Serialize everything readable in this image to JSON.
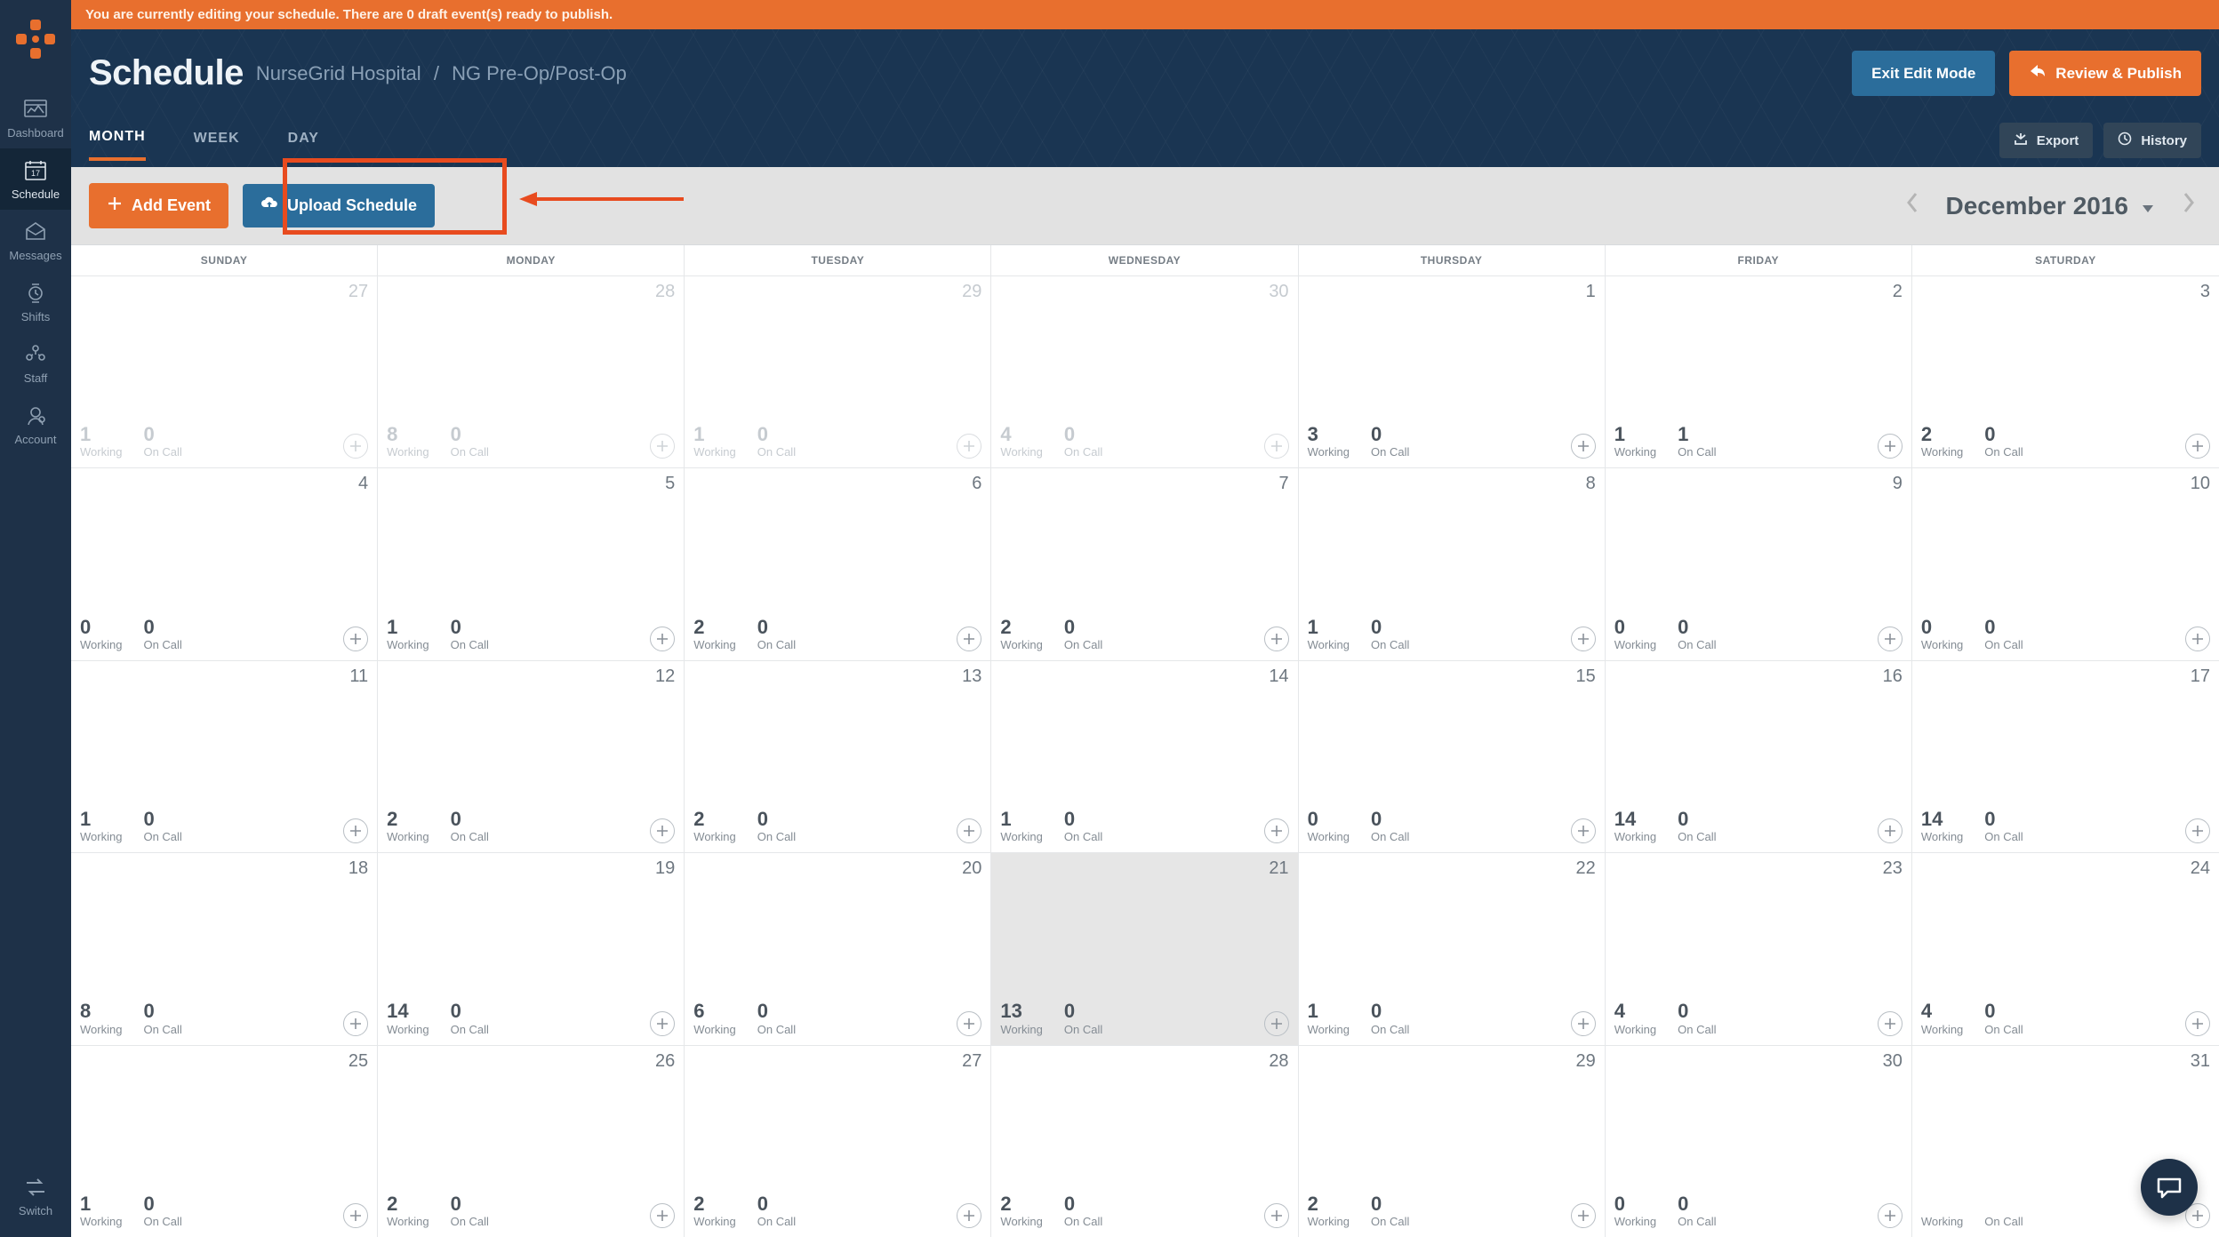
{
  "banner": "You are currently editing your schedule. There are 0 draft event(s) ready to publish.",
  "sidebar": {
    "items": [
      {
        "label": "Dashboard"
      },
      {
        "label": "Schedule"
      },
      {
        "label": "Messages"
      },
      {
        "label": "Shifts"
      },
      {
        "label": "Staff"
      },
      {
        "label": "Account"
      }
    ],
    "switch_label": "Switch"
  },
  "header": {
    "title": "Schedule",
    "crumb1": "NurseGrid Hospital",
    "crumb2": "NG Pre-Op/Post-Op",
    "exit_label": "Exit Edit Mode",
    "publish_label": "Review & Publish"
  },
  "tabs": {
    "month": "MONTH",
    "week": "WEEK",
    "day": "DAY",
    "export": "Export",
    "history": "History"
  },
  "toolbar": {
    "add_event": "Add Event",
    "upload": "Upload Schedule"
  },
  "month_nav": {
    "label": "December 2016"
  },
  "dow": [
    "SUNDAY",
    "MONDAY",
    "TUESDAY",
    "WEDNESDAY",
    "THURSDAY",
    "FRIDAY",
    "SATURDAY"
  ],
  "labels": {
    "working": "Working",
    "oncall": "On Call"
  },
  "weeks": [
    [
      {
        "num": 27,
        "outside": true,
        "working": 1,
        "oncall": 0
      },
      {
        "num": 28,
        "outside": true,
        "working": 8,
        "oncall": 0
      },
      {
        "num": 29,
        "outside": true,
        "working": 1,
        "oncall": 0
      },
      {
        "num": 30,
        "outside": true,
        "working": 4,
        "oncall": 0
      },
      {
        "num": 1,
        "outside": false,
        "working": 3,
        "oncall": 0
      },
      {
        "num": 2,
        "outside": false,
        "working": 1,
        "oncall": 1
      },
      {
        "num": 3,
        "outside": false,
        "working": 2,
        "oncall": 0
      }
    ],
    [
      {
        "num": 4,
        "outside": false,
        "working": 0,
        "oncall": 0
      },
      {
        "num": 5,
        "outside": false,
        "working": 1,
        "oncall": 0
      },
      {
        "num": 6,
        "outside": false,
        "working": 2,
        "oncall": 0
      },
      {
        "num": 7,
        "outside": false,
        "working": 2,
        "oncall": 0
      },
      {
        "num": 8,
        "outside": false,
        "working": 1,
        "oncall": 0
      },
      {
        "num": 9,
        "outside": false,
        "working": 0,
        "oncall": 0
      },
      {
        "num": 10,
        "outside": false,
        "working": 0,
        "oncall": 0
      }
    ],
    [
      {
        "num": 11,
        "outside": false,
        "working": 1,
        "oncall": 0
      },
      {
        "num": 12,
        "outside": false,
        "working": 2,
        "oncall": 0
      },
      {
        "num": 13,
        "outside": false,
        "working": 2,
        "oncall": 0
      },
      {
        "num": 14,
        "outside": false,
        "working": 1,
        "oncall": 0
      },
      {
        "num": 15,
        "outside": false,
        "working": 0,
        "oncall": 0
      },
      {
        "num": 16,
        "outside": false,
        "working": 14,
        "oncall": 0
      },
      {
        "num": 17,
        "outside": false,
        "working": 14,
        "oncall": 0
      }
    ],
    [
      {
        "num": 18,
        "outside": false,
        "working": 8,
        "oncall": 0
      },
      {
        "num": 19,
        "outside": false,
        "working": 14,
        "oncall": 0
      },
      {
        "num": 20,
        "outside": false,
        "working": 6,
        "oncall": 0
      },
      {
        "num": 21,
        "outside": false,
        "today": true,
        "working": 13,
        "oncall": 0
      },
      {
        "num": 22,
        "outside": false,
        "working": 1,
        "oncall": 0
      },
      {
        "num": 23,
        "outside": false,
        "working": 4,
        "oncall": 0
      },
      {
        "num": 24,
        "outside": false,
        "working": 4,
        "oncall": 0
      }
    ],
    [
      {
        "num": 25,
        "outside": false,
        "working": 1,
        "oncall": 0
      },
      {
        "num": 26,
        "outside": false,
        "working": 2,
        "oncall": 0
      },
      {
        "num": 27,
        "outside": false,
        "working": 2,
        "oncall": 0
      },
      {
        "num": 28,
        "outside": false,
        "working": 2,
        "oncall": 0
      },
      {
        "num": 29,
        "outside": false,
        "working": 2,
        "oncall": 0
      },
      {
        "num": 30,
        "outside": false,
        "working": 0,
        "oncall": 0
      },
      {
        "num": 31,
        "outside": false,
        "working": "",
        "oncall": ""
      }
    ]
  ]
}
